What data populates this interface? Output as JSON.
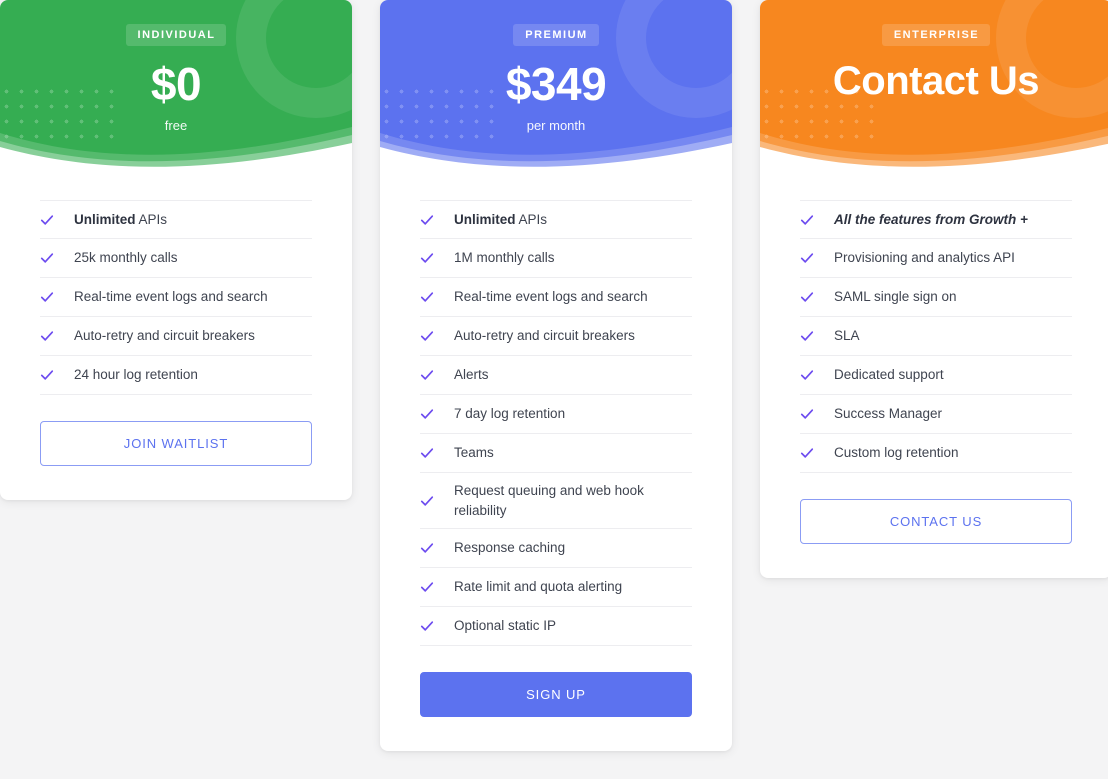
{
  "page": {
    "background_color": "#f4f4f5",
    "accent_color": "#5c72ef",
    "check_color": "#6c4bef"
  },
  "plans": [
    {
      "id": "individual",
      "badge": "INDIVIDUAL",
      "price": "$0",
      "period": "free",
      "header_color": "#35ad52",
      "features": [
        {
          "prefix": "Unlimited",
          "text": " APIs",
          "style": "bold-prefix"
        },
        {
          "text": "25k monthly calls",
          "style": "normal"
        },
        {
          "text": "Real-time event logs and search",
          "style": "normal"
        },
        {
          "text": "Auto-retry and circuit breakers",
          "style": "normal"
        },
        {
          "text": "24 hour log retention",
          "style": "normal"
        }
      ],
      "cta": {
        "label": "JOIN WAITLIST",
        "variant": "outline"
      }
    },
    {
      "id": "premium",
      "badge": "PREMIUM",
      "price": "$349",
      "period": "per month",
      "header_color": "#5c72ef",
      "features": [
        {
          "prefix": "Unlimited",
          "text": " APIs",
          "style": "bold-prefix"
        },
        {
          "text": "1M monthly calls",
          "style": "normal"
        },
        {
          "text": "Real-time event logs and search",
          "style": "normal"
        },
        {
          "text": "Auto-retry and circuit breakers",
          "style": "normal"
        },
        {
          "text": "Alerts",
          "style": "normal"
        },
        {
          "text": "7 day log retention",
          "style": "normal"
        },
        {
          "text": "Teams",
          "style": "normal"
        },
        {
          "text": "Request queuing and web hook reliability",
          "style": "normal"
        },
        {
          "text": "Response caching",
          "style": "normal"
        },
        {
          "text": "Rate limit and quota alerting",
          "style": "normal"
        },
        {
          "text": "Optional static IP",
          "style": "normal"
        }
      ],
      "cta": {
        "label": "SIGN UP",
        "variant": "solid"
      }
    },
    {
      "id": "enterprise",
      "badge": "ENTERPRISE",
      "price": "Contact Us",
      "period": "",
      "header_color": "#f7871f",
      "features": [
        {
          "text": "All the features from Growth +",
          "style": "bold-italic"
        },
        {
          "text": "Provisioning and analytics API",
          "style": "normal"
        },
        {
          "text": "SAML single sign on",
          "style": "normal"
        },
        {
          "text": "SLA",
          "style": "normal"
        },
        {
          "text": "Dedicated support",
          "style": "normal"
        },
        {
          "text": "Success Manager",
          "style": "normal"
        },
        {
          "text": "Custom log retention",
          "style": "normal"
        }
      ],
      "cta": {
        "label": "CONTACT US",
        "variant": "outline"
      }
    }
  ],
  "icons": {
    "check": "check-icon"
  }
}
